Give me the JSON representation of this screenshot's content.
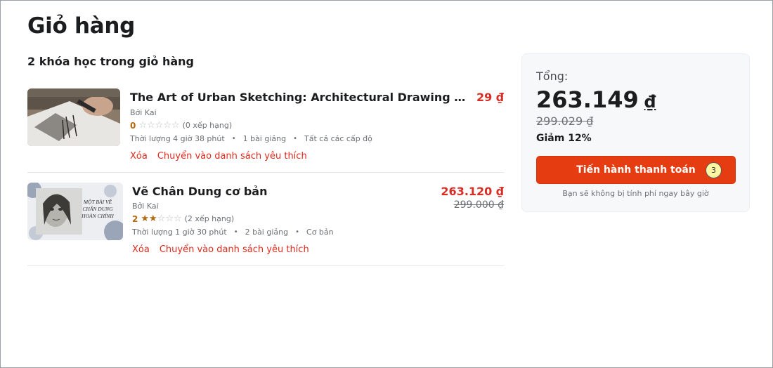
{
  "page": {
    "title": "Giỏ hàng",
    "cart_count_text": "2 khóa học trong giỏ hàng"
  },
  "courses": [
    {
      "title": "The Art of Urban Sketching: Architectural Drawing with Pen ...",
      "author": "Bởi Kai",
      "rating_value": "0",
      "stars_filled": 0,
      "stars_total": 5,
      "rating_count": "(0 xếp hạng)",
      "duration": "Thời lượng 4 giờ 38 phút",
      "lectures": "1 bài giảng",
      "level": "Tất cả các cấp độ",
      "remove_label": "Xóa",
      "wishlist_label": "Chuyển vào danh sách yêu thích",
      "price": "29 ₫",
      "old_price": ""
    },
    {
      "title": "Vẽ Chân Dung cơ bản",
      "author": "Bởi Kai",
      "rating_value": "2",
      "stars_filled": 2,
      "stars_total": 5,
      "rating_count": "(2 xếp hạng)",
      "duration": "Thời lượng 1 giờ 30 phút",
      "lectures": "2 bài giảng",
      "level": "Cơ bản",
      "remove_label": "Xóa",
      "wishlist_label": "Chuyển vào danh sách yêu thích",
      "price": "263.120 ₫",
      "old_price": "299.000 ₫",
      "thumb_text": "MỘT BÀI VẼ CHÂN DUNG HOÀN CHỈNH"
    }
  ],
  "summary": {
    "label": "Tổng:",
    "total": "263.149",
    "currency": "₫",
    "old_total": "299.029 ₫",
    "discount": "Giảm 12%",
    "checkout_label": "Tiến hành thanh toán",
    "badge": "3",
    "note": "Bạn sẽ không bị tính phí ngay bây giờ"
  },
  "colors": {
    "accent": "#e63c12",
    "price_red": "#d82d24",
    "link_red": "#e02b1d",
    "rating": "#b4690e"
  }
}
